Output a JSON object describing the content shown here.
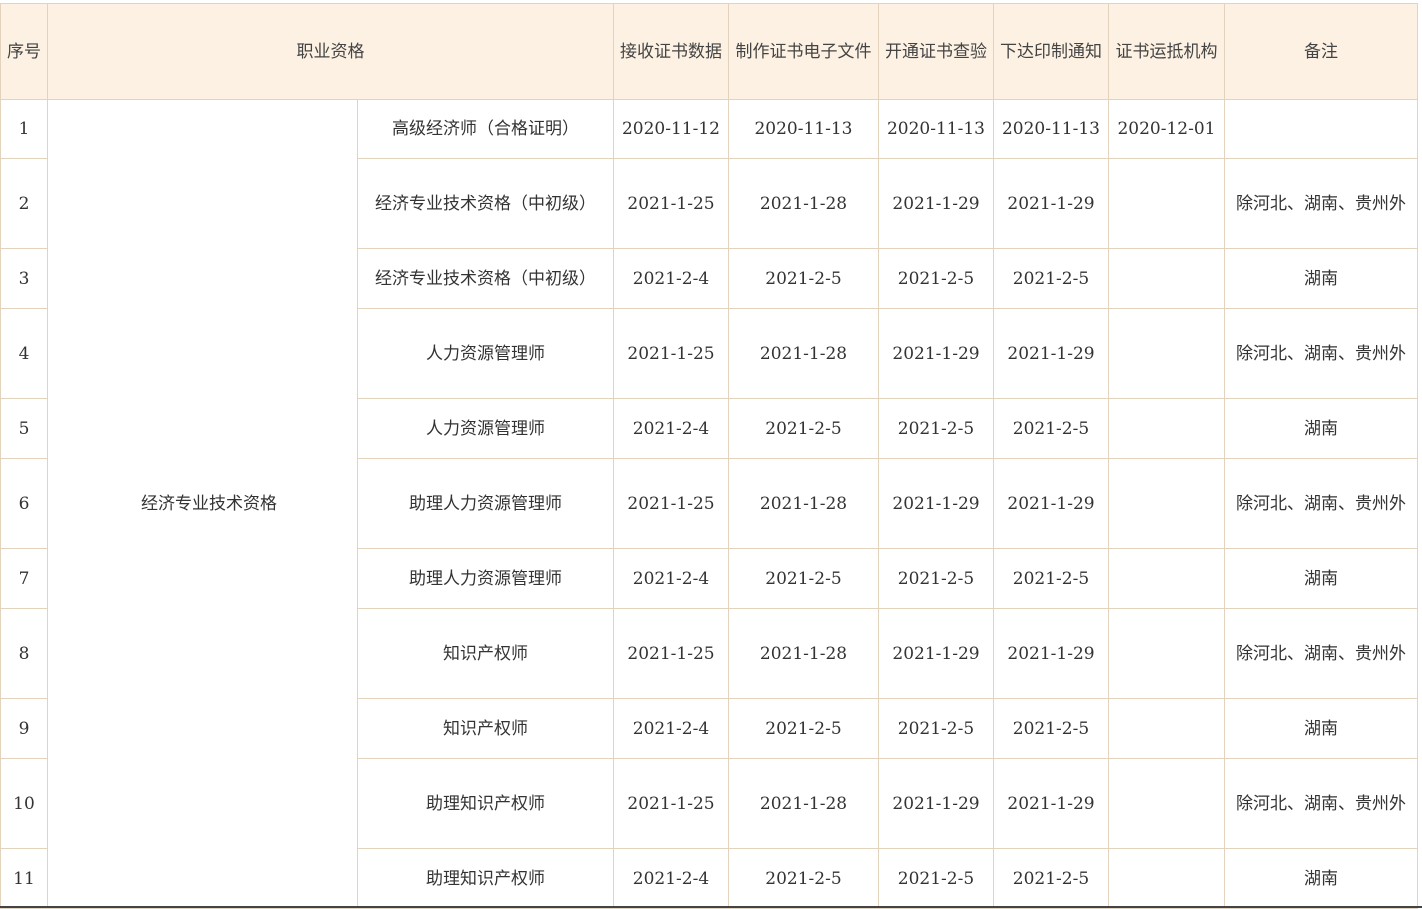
{
  "table": {
    "headers": {
      "seq": "序号",
      "qualification": "职业资格",
      "receive": "接收证书数据",
      "produce": "制作证书电子文件",
      "verify": "开通证书查验",
      "print_notice": "下达印制通知",
      "arrive": "证书运抵机构",
      "remark": "备注"
    },
    "category": "经济专业技术资格",
    "rows": [
      {
        "seq": "1",
        "name": "高级经济师（合格证明）",
        "receive": "2020-11-12",
        "produce": "2020-11-13",
        "verify": "2020-11-13",
        "print_notice": "2020-11-13",
        "arrive": "2020-12-01",
        "remark": ""
      },
      {
        "seq": "2",
        "name": "经济专业技术资格（中初级）",
        "receive": "2021-1-25",
        "produce": "2021-1-28",
        "verify": "2021-1-29",
        "print_notice": "2021-1-29",
        "arrive": "",
        "remark": "除河北、湖南、贵州外"
      },
      {
        "seq": "3",
        "name": "经济专业技术资格（中初级）",
        "receive": "2021-2-4",
        "produce": "2021-2-5",
        "verify": "2021-2-5",
        "print_notice": "2021-2-5",
        "arrive": "",
        "remark": "湖南"
      },
      {
        "seq": "4",
        "name": "人力资源管理师",
        "receive": "2021-1-25",
        "produce": "2021-1-28",
        "verify": "2021-1-29",
        "print_notice": "2021-1-29",
        "arrive": "",
        "remark": "除河北、湖南、贵州外"
      },
      {
        "seq": "5",
        "name": "人力资源管理师",
        "receive": "2021-2-4",
        "produce": "2021-2-5",
        "verify": "2021-2-5",
        "print_notice": "2021-2-5",
        "arrive": "",
        "remark": "湖南"
      },
      {
        "seq": "6",
        "name": "助理人力资源管理师",
        "receive": "2021-1-25",
        "produce": "2021-1-28",
        "verify": "2021-1-29",
        "print_notice": "2021-1-29",
        "arrive": "",
        "remark": "除河北、湖南、贵州外"
      },
      {
        "seq": "7",
        "name": "助理人力资源管理师",
        "receive": "2021-2-4",
        "produce": "2021-2-5",
        "verify": "2021-2-5",
        "print_notice": "2021-2-5",
        "arrive": "",
        "remark": "湖南"
      },
      {
        "seq": "8",
        "name": "知识产权师",
        "receive": "2021-1-25",
        "produce": "2021-1-28",
        "verify": "2021-1-29",
        "print_notice": "2021-1-29",
        "arrive": "",
        "remark": "除河北、湖南、贵州外"
      },
      {
        "seq": "9",
        "name": "知识产权师",
        "receive": "2021-2-4",
        "produce": "2021-2-5",
        "verify": "2021-2-5",
        "print_notice": "2021-2-5",
        "arrive": "",
        "remark": "湖南"
      },
      {
        "seq": "10",
        "name": "助理知识产权师",
        "receive": "2021-1-25",
        "produce": "2021-1-28",
        "verify": "2021-1-29",
        "print_notice": "2021-1-29",
        "arrive": "",
        "remark": "除河北、湖南、贵州外"
      },
      {
        "seq": "11",
        "name": "助理知识产权师",
        "receive": "2021-2-4",
        "produce": "2021-2-5",
        "verify": "2021-2-5",
        "print_notice": "2021-2-5",
        "arrive": "",
        "remark": "湖南"
      }
    ]
  },
  "colors": {
    "header_background": "#fdf1e3",
    "border": "#e3d3bd",
    "text": "#333333"
  }
}
